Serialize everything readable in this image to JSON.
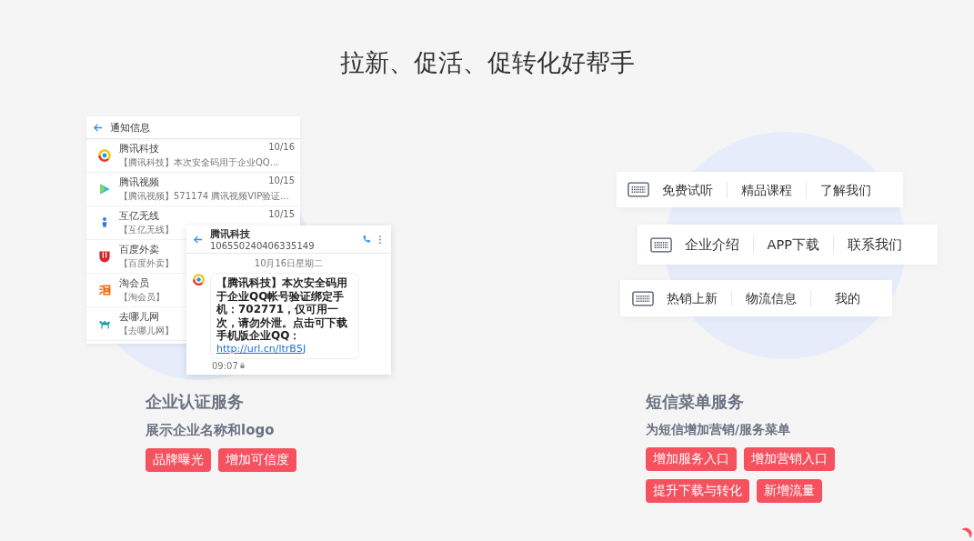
{
  "heading": "拉新、促活、促转化好帮手",
  "inbox": {
    "title": "通知信息",
    "items": [
      {
        "kind": "ring",
        "sender": "腾讯科技",
        "date": "10/16",
        "preview": "【腾讯科技】本次安全码用于企业QQ..."
      },
      {
        "kind": "play",
        "sender": "腾讯视频",
        "date": "10/15",
        "preview": "【腾讯视频】571174 腾讯视频VIP验证..."
      },
      {
        "kind": "figure",
        "sender": "互亿无线",
        "date": "10/15",
        "preview": "【互亿无线】"
      },
      {
        "kind": "shield",
        "sender": "百度外卖",
        "preview": "【百度外卖】"
      },
      {
        "kind": "swirl",
        "sender": "淘会员",
        "preview": "【淘会员】"
      },
      {
        "kind": "camel",
        "sender": "去哪儿网",
        "preview": "【去哪儿网】"
      }
    ]
  },
  "message": {
    "sender": "腾讯科技",
    "number": "106550240406335149",
    "date": "10月16日星期二",
    "body": "【腾讯科技】本次安全码用于企业QQ帐号验证绑定手机：702771，仅可用一次，请勿外泄。点击可下载手机版企业QQ：",
    "link": "http://url.cn/ltrB5J",
    "time": "09:07"
  },
  "menus": [
    {
      "items": [
        "免费试听",
        "精品课程",
        "了解我们"
      ]
    },
    {
      "items": [
        "企业介绍",
        "APP下载",
        "联系我们"
      ]
    },
    {
      "items": [
        "热销上新",
        "物流信息",
        "我的"
      ]
    }
  ],
  "services": [
    {
      "title": "企业认证服务",
      "subtitle": "展示企业名称和logo",
      "tags": [
        "品牌曝光",
        "增加可信度"
      ]
    },
    {
      "title": "短信菜单服务",
      "subtitle": "为短信增加营销/服务菜单",
      "tags": [
        "增加服务入口",
        "增加营销入口",
        "提升下载与转化",
        "新增流量"
      ]
    }
  ]
}
